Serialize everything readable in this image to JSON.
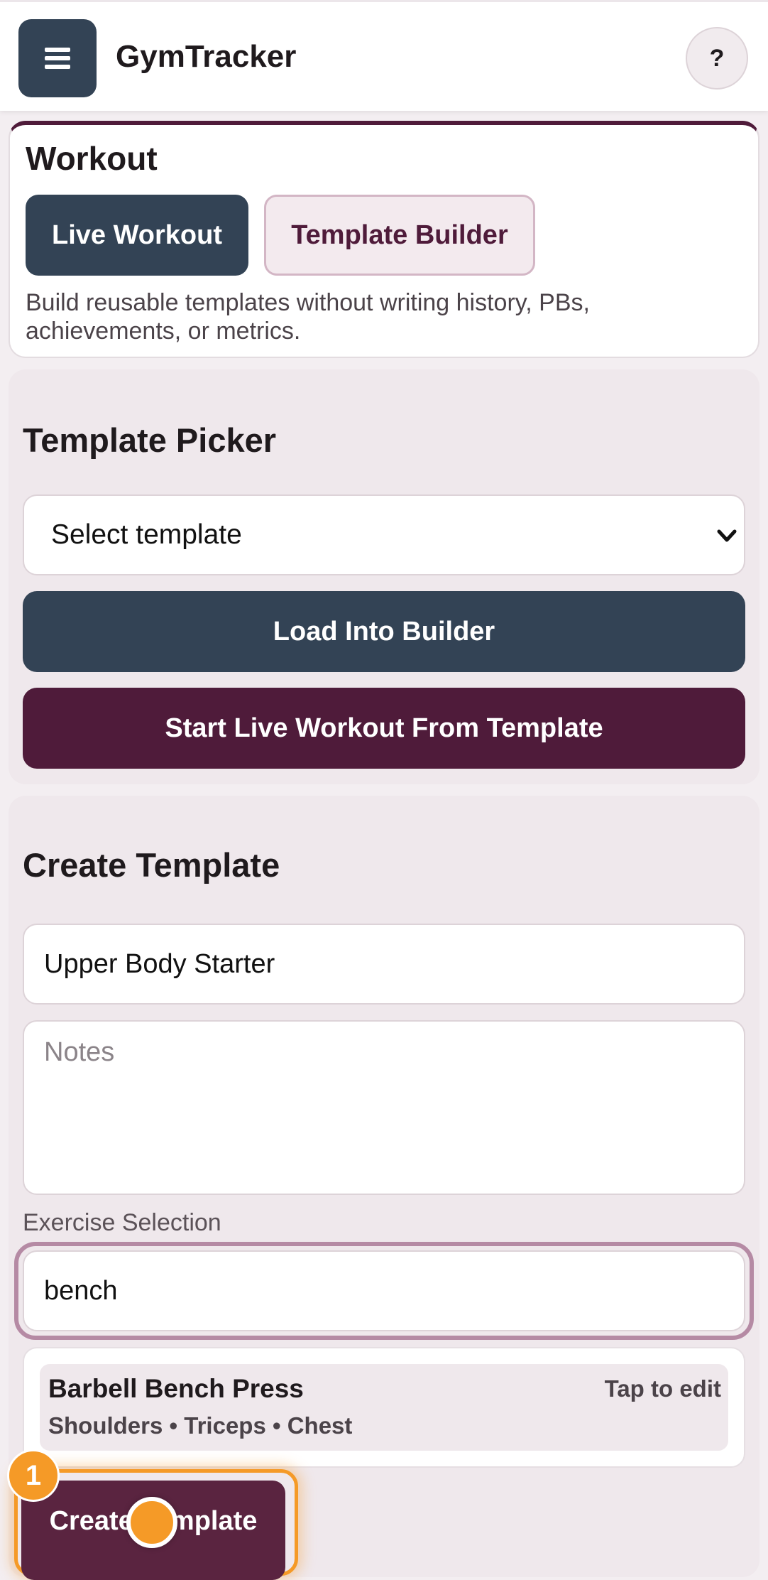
{
  "header": {
    "app_title": "GymTracker",
    "help_label": "?"
  },
  "workout": {
    "title": "Workout",
    "live_label": "Live Workout",
    "builder_label": "Template Builder",
    "description": "Build reusable templates without writing history, PBs, achievements, or metrics."
  },
  "picker": {
    "title": "Template Picker",
    "select_value": "Select template",
    "load_label": "Load Into Builder",
    "start_label": "Start Live Workout From Template"
  },
  "create": {
    "title": "Create Template",
    "name_value": "Upper Body Starter",
    "notes_placeholder": "Notes",
    "exercise_label": "Exercise Selection",
    "search_value": "bench",
    "results": [
      {
        "name": "Barbell Bench Press",
        "action": "Tap to edit",
        "muscles": "Shoulders • Triceps • Chest"
      }
    ],
    "create_label": "Create Template"
  },
  "overlay": {
    "step_number": "1"
  },
  "colors": {
    "primary_dark": "#334355",
    "accent_plum": "#4f1b3a",
    "highlight_orange": "#f59a27",
    "page_bg": "#f3eef1"
  }
}
